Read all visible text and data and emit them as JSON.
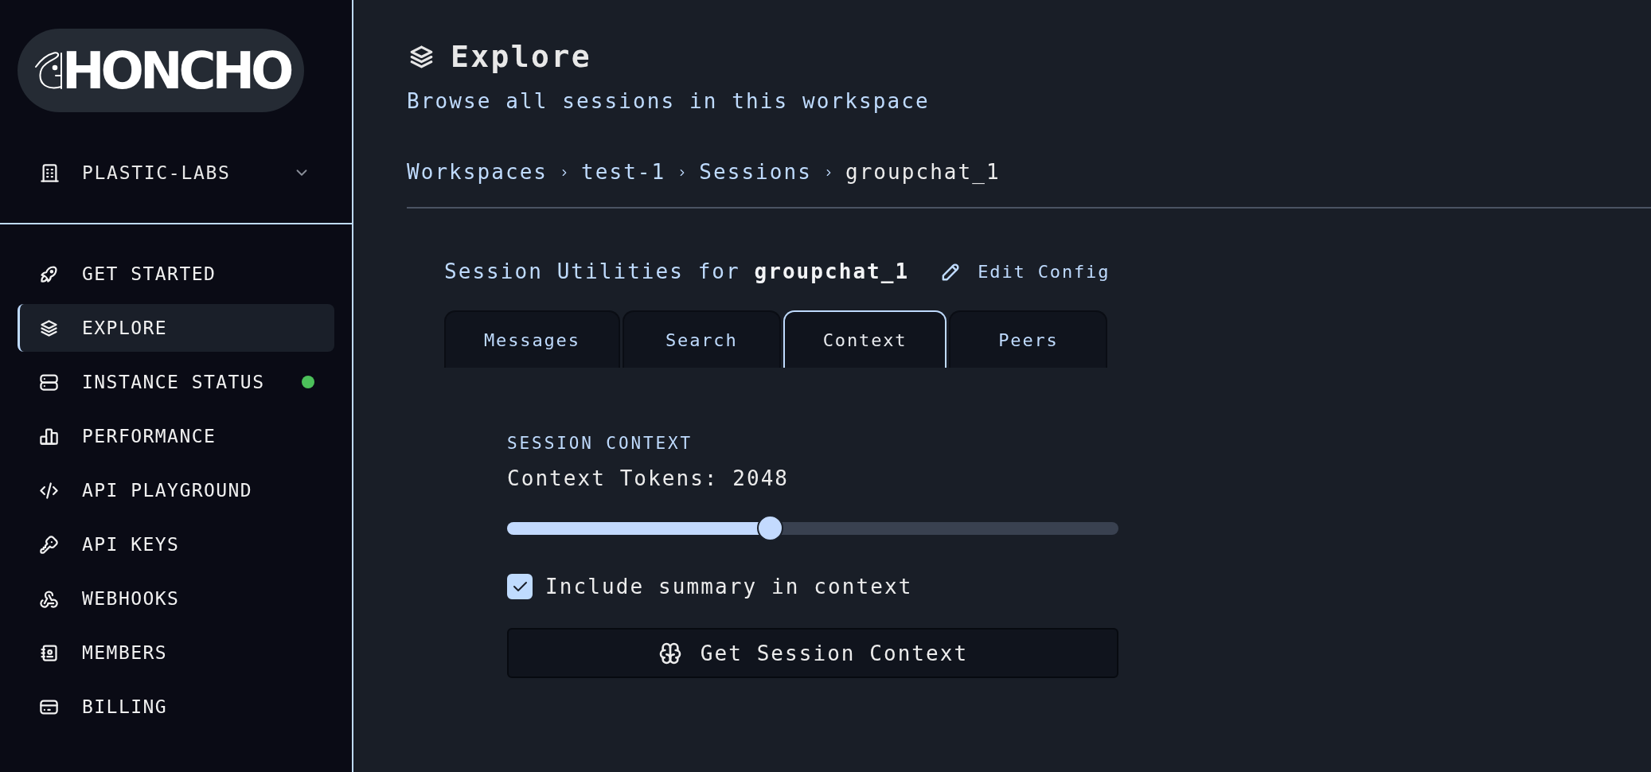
{
  "sidebar": {
    "logo": {
      "text": "HONCHO"
    },
    "org_selector": {
      "label": "PLASTIC-LABS"
    },
    "items": [
      {
        "label": "GET STARTED",
        "selected": false
      },
      {
        "label": "EXPLORE",
        "selected": true
      },
      {
        "label": "INSTANCE STATUS",
        "selected": false,
        "color": "#4cc05a"
      },
      {
        "label": "PERFORMANCE",
        "selected": false
      },
      {
        "label": "API PLAYGROUND",
        "selected": false
      },
      {
        "label": "API KEYS",
        "selected": false
      },
      {
        "label": "WEBHOOKS",
        "selected": false
      },
      {
        "label": "MEMBERS",
        "selected": false
      },
      {
        "label": "BILLING",
        "selected": false
      }
    ]
  },
  "main": {
    "header": {
      "title": "Explore",
      "subtitle": "Browse all sessions in this workspace"
    },
    "breadcrumb": [
      {
        "label": "Workspaces",
        "current": false
      },
      {
        "label": "test-1",
        "current": false
      },
      {
        "label": "Sessions",
        "current": false
      },
      {
        "label": "groupchat_1",
        "current": true
      }
    ],
    "session": {
      "title": "Session Utilities for **groupchat_1**",
      "edit_button": "Edit Config",
      "tabs": [
        {
          "label": "Messages",
          "selected": false
        },
        {
          "label": "Search",
          "selected": false
        },
        {
          "label": "Context",
          "selected": true
        },
        {
          "label": "Peers",
          "selected": false
        }
      ],
      "context": {
        "heading": "SESSION CONTEXT",
        "tokens_label": "Context Tokens: 2048",
        "slider": {
          "level": 0.43
        },
        "include_summary": {
          "label": "Include summary in context",
          "checked": true
        },
        "submit_button": "Get Session Context"
      }
    }
  }
}
